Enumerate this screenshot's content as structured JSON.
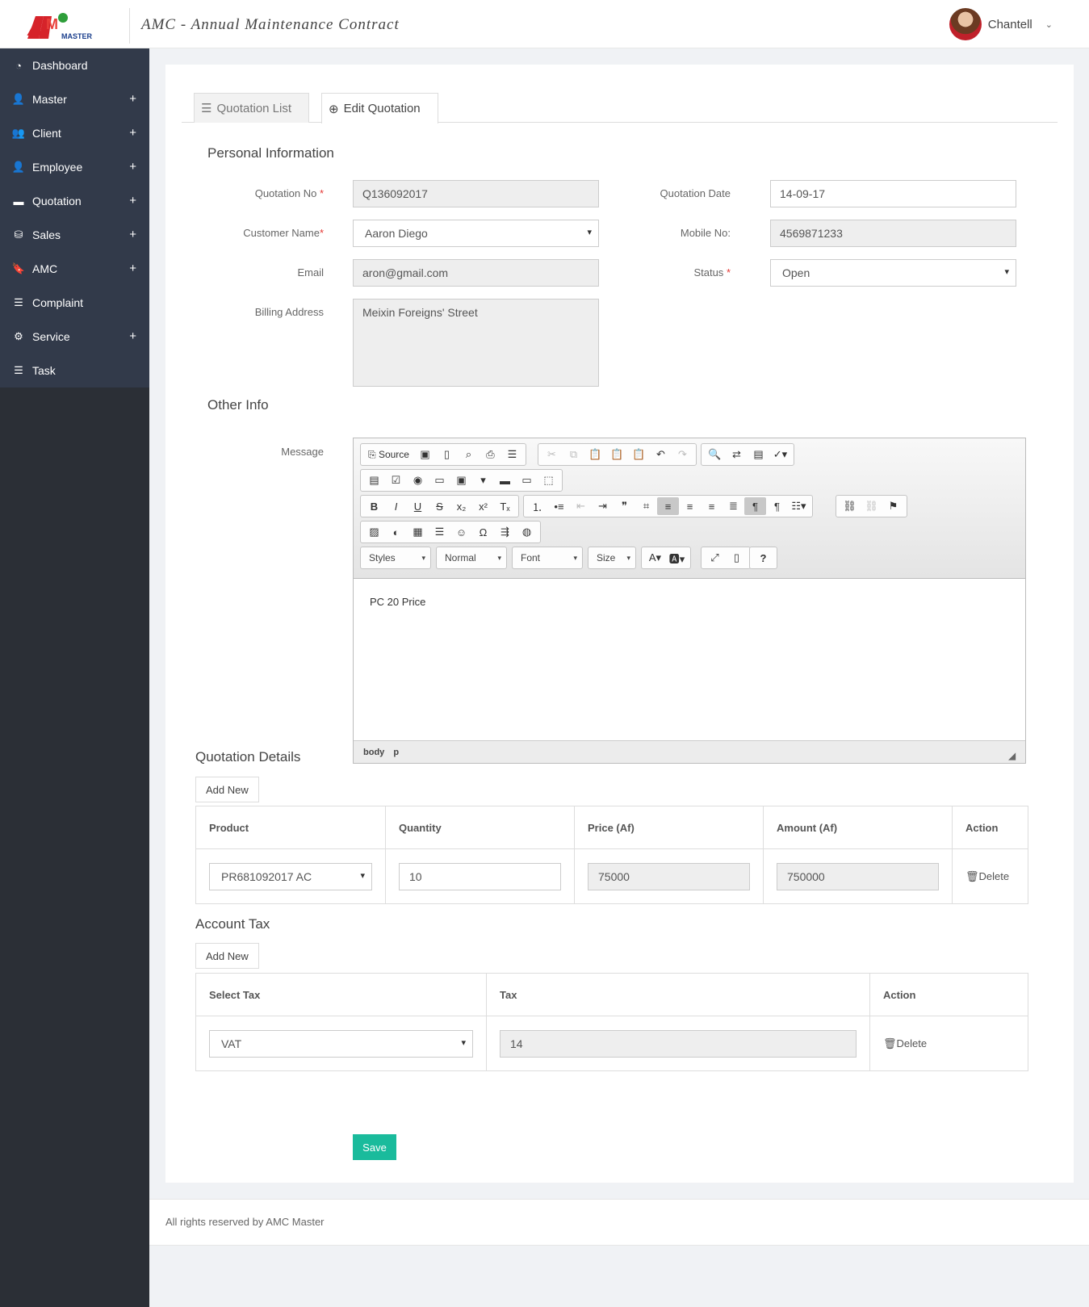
{
  "header": {
    "logo_text": "AMC MASTER",
    "app_title": "AMC - Annual Maintenance Contract",
    "user_name": "Chantell"
  },
  "sidebar": {
    "items": [
      {
        "label": "Dashboard",
        "icon": "dashboard-icon",
        "expandable": false
      },
      {
        "label": "Master",
        "icon": "user-icon",
        "expandable": true
      },
      {
        "label": "Client",
        "icon": "users-icon",
        "expandable": true
      },
      {
        "label": "Employee",
        "icon": "user-plus-icon",
        "expandable": true
      },
      {
        "label": "Quotation",
        "icon": "credit-card-icon",
        "expandable": true
      },
      {
        "label": "Sales",
        "icon": "hdd-icon",
        "expandable": true
      },
      {
        "label": "AMC",
        "icon": "bookmark-icon",
        "expandable": true
      },
      {
        "label": "Complaint",
        "icon": "list-alt-icon",
        "expandable": false
      },
      {
        "label": "Service",
        "icon": "cog-icon",
        "expandable": true
      },
      {
        "label": "Task",
        "icon": "tasks-icon",
        "expandable": false
      }
    ],
    "plus": "+"
  },
  "tabs": {
    "list": "Quotation List",
    "edit": "Edit Quotation"
  },
  "personal": {
    "title": "Personal Information",
    "quotation_no_label": "Quotation No",
    "quotation_no": "Q136092017",
    "quotation_date_label": "Quotation Date",
    "quotation_date": "14-09-17",
    "customer_name_label": "Customer Name",
    "customer_name": "Aaron Diego",
    "mobile_label": "Mobile No:",
    "mobile": "4569871233",
    "email_label": "Email",
    "email": "aron@gmail.com",
    "status_label": "Status",
    "status": "Open",
    "billing_label": "Billing Address",
    "billing": "Meixin Foreigns' Street",
    "required_mark": "*"
  },
  "other": {
    "title": "Other Info",
    "message_label": "Message",
    "editor": {
      "source_label": "Source",
      "styles": "Styles",
      "format": "Normal",
      "font": "Font",
      "size": "Size",
      "content": "PC 20 Price",
      "path": [
        "body",
        "p"
      ]
    }
  },
  "details": {
    "title": "Quotation Details",
    "add_label": "Add New",
    "headers": [
      "Product",
      "Quantity",
      "Price (Af)",
      "Amount (Af)",
      "Action"
    ],
    "rows": [
      {
        "product": "PR681092017 AC",
        "quantity": "10",
        "price": "75000",
        "amount": "750000",
        "action": "Delete"
      }
    ]
  },
  "tax": {
    "title": "Account Tax",
    "add_label": "Add New",
    "headers": [
      "Select Tax",
      "Tax",
      "Action"
    ],
    "rows": [
      {
        "tax_name": "VAT",
        "tax": "14",
        "action": "Delete"
      }
    ]
  },
  "save_label": "Save",
  "footer": "All rights reserved by AMC Master",
  "colors": {
    "sidebar_dark": "#2b2f36",
    "nav_bg": "#323a4a",
    "save_btn": "#1abb9c",
    "required": "#e53935"
  }
}
